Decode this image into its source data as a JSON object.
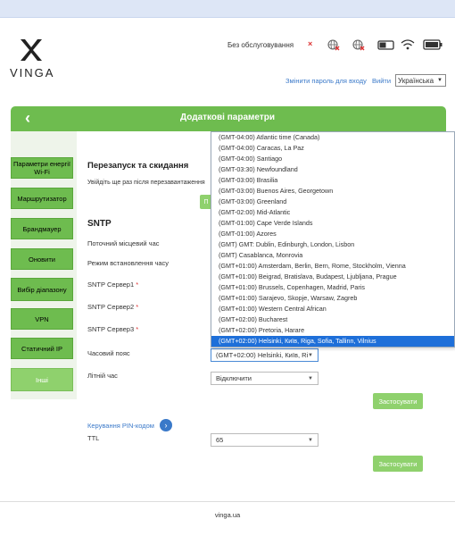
{
  "brand": {
    "name": "VINGA"
  },
  "status": {
    "service_text": "Без обслуговування"
  },
  "header": {
    "change_password_link": "Змінити пароль для входу",
    "logout_link": "Вийти",
    "language": "Українська"
  },
  "title_bar": {
    "title": "Додаткові параметри"
  },
  "sidebar": {
    "items": [
      {
        "label": "Параметри енергії Wi-Fi",
        "active": false
      },
      {
        "label": "Маршрутизатор",
        "active": false
      },
      {
        "label": "Брандмауер",
        "active": false
      },
      {
        "label": "Оновити",
        "active": false
      },
      {
        "label": "Вибір діапазону",
        "active": false
      },
      {
        "label": "VPN",
        "active": false
      },
      {
        "label": "Статичний IP",
        "active": false
      },
      {
        "label": "Інші",
        "active": true
      }
    ]
  },
  "reboot": {
    "title": "Перезапуск та скидання",
    "hint": "Увійдіть ще раз після перезавантаження",
    "button_partial": "П"
  },
  "sntp": {
    "title": "SNTP",
    "local_time_label": "Поточний місцевий час",
    "mode_label": "Режим встановлення часу",
    "server1_label": "SNTP Сервер1",
    "server2_label": "SNTP Сервер2",
    "server3_label": "SNTP Сервер3",
    "required_mark": "*",
    "timezone_label": "Часовий пояс",
    "timezone_value": "(GMT+02:00) Helsinki, Київ, Riga",
    "dst_label": "Літній час",
    "dst_value": "Відключити",
    "apply_button": "Застосувати"
  },
  "timezone_options": [
    "(GMT-04:00) Atlantic time (Canada)",
    "(GMT-04:00) Caracas, La Paz",
    "(GMT-04:00) Santiago",
    "(GMT-03:30) Newfoundland",
    "(GMT-03:00) Brasilia",
    "(GMT-03:00) Buenos Aires, Georgetown",
    "(GMT-03:00) Greenland",
    "(GMT-02:00) Mid-Atlantic",
    "(GMT-01:00) Cape Verde Islands",
    "(GMT-01:00) Azores",
    "(GMT) GMT: Dublin, Edinburgh, London, Lisbon",
    "(GMT) Casablanca, Monrovia",
    "(GMT+01:00) Amsterdam, Berlin, Bern, Rome, Stockholm, Vienna",
    "(GMT+01:00) Beigrad, Bratislava, Budapest, Ljubljana, Prague",
    "(GMT+01:00) Brussels, Copenhagen, Madrid, Paris",
    "(GMT+01:00) Sarajevo, Skopje, Warsaw, Zagreb",
    "(GMT+01:00) Western Central African",
    "(GMT+02:00) Bucharest",
    "(GMT+02:00) Pretoria, Harare",
    "(GMT+02:00) Helsinki, Київ, Riga, Sofia, Tallinn, Vilnius"
  ],
  "timezone_selected_index": 19,
  "pin": {
    "link": "Керування PIN-кодом",
    "arrow": "›",
    "ttl_label": "TTL",
    "ttl_value": "65",
    "apply_button": "Застосувати"
  },
  "footer": {
    "text": "vinga.ua"
  },
  "icons": {
    "no_signal": "no-signal-icon",
    "roaming_off": "globe-off-icon",
    "toggle": "toggle-icon",
    "wifi": "wifi-icon",
    "battery": "battery-icon"
  },
  "colors": {
    "accent_green": "#6ebc4f",
    "link_blue": "#3a79c9",
    "selected_blue": "#1e6fd9"
  }
}
